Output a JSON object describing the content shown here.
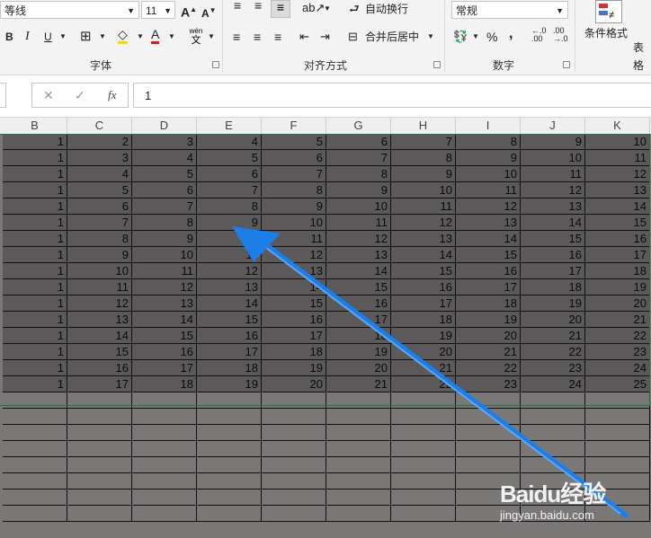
{
  "ribbon": {
    "font_name": "等线",
    "font_size": "11",
    "bold": "B",
    "italic": "I",
    "underline": "U",
    "phonetic_top": "wén",
    "phonetic_bottom": "文",
    "font_group_label": "字体",
    "wrap_text_label": "自动换行",
    "merge_center_label": "合并后居中",
    "alignment_group_label": "对齐方式",
    "number_format": "常规",
    "percent": "%",
    "comma": ",",
    "number_group_label": "数字",
    "conditional_format_label": "条件格式",
    "table_format_label_partial": "表格"
  },
  "formula_bar": {
    "fx": "fx",
    "value": "1"
  },
  "columns": [
    "B",
    "C",
    "D",
    "E",
    "F",
    "G",
    "H",
    "I",
    "J",
    "K"
  ],
  "rows": [
    [
      1,
      2,
      3,
      4,
      5,
      6,
      7,
      8,
      9,
      10
    ],
    [
      1,
      3,
      4,
      5,
      6,
      7,
      8,
      9,
      10,
      11
    ],
    [
      1,
      4,
      5,
      6,
      7,
      8,
      9,
      10,
      11,
      12
    ],
    [
      1,
      5,
      6,
      7,
      8,
      9,
      10,
      11,
      12,
      13
    ],
    [
      1,
      6,
      7,
      8,
      9,
      10,
      11,
      12,
      13,
      14
    ],
    [
      1,
      7,
      8,
      9,
      10,
      11,
      12,
      13,
      14,
      15
    ],
    [
      1,
      8,
      9,
      10,
      11,
      12,
      13,
      14,
      15,
      16
    ],
    [
      1,
      9,
      10,
      11,
      12,
      13,
      14,
      15,
      16,
      17
    ],
    [
      1,
      10,
      11,
      12,
      13,
      14,
      15,
      16,
      17,
      18
    ],
    [
      1,
      11,
      12,
      13,
      14,
      15,
      16,
      17,
      18,
      19
    ],
    [
      1,
      12,
      13,
      14,
      15,
      16,
      17,
      18,
      19,
      20
    ],
    [
      1,
      13,
      14,
      15,
      16,
      17,
      18,
      19,
      20,
      21
    ],
    [
      1,
      14,
      15,
      16,
      17,
      18,
      19,
      20,
      21,
      22
    ],
    [
      1,
      15,
      16,
      17,
      18,
      19,
      20,
      21,
      22,
      23
    ],
    [
      1,
      16,
      17,
      18,
      19,
      20,
      21,
      22,
      23,
      24
    ],
    [
      1,
      17,
      18,
      19,
      20,
      21,
      22,
      23,
      24,
      25
    ]
  ],
  "empty_rows": 8,
  "watermark": {
    "brand": "Baidu经验",
    "url": "jingyan.baidu.com"
  },
  "colors": {
    "selection": "#5b5959",
    "empty_cells": "#7a7777",
    "arrow": "#1e7ee8",
    "selection_border": "#217346"
  }
}
